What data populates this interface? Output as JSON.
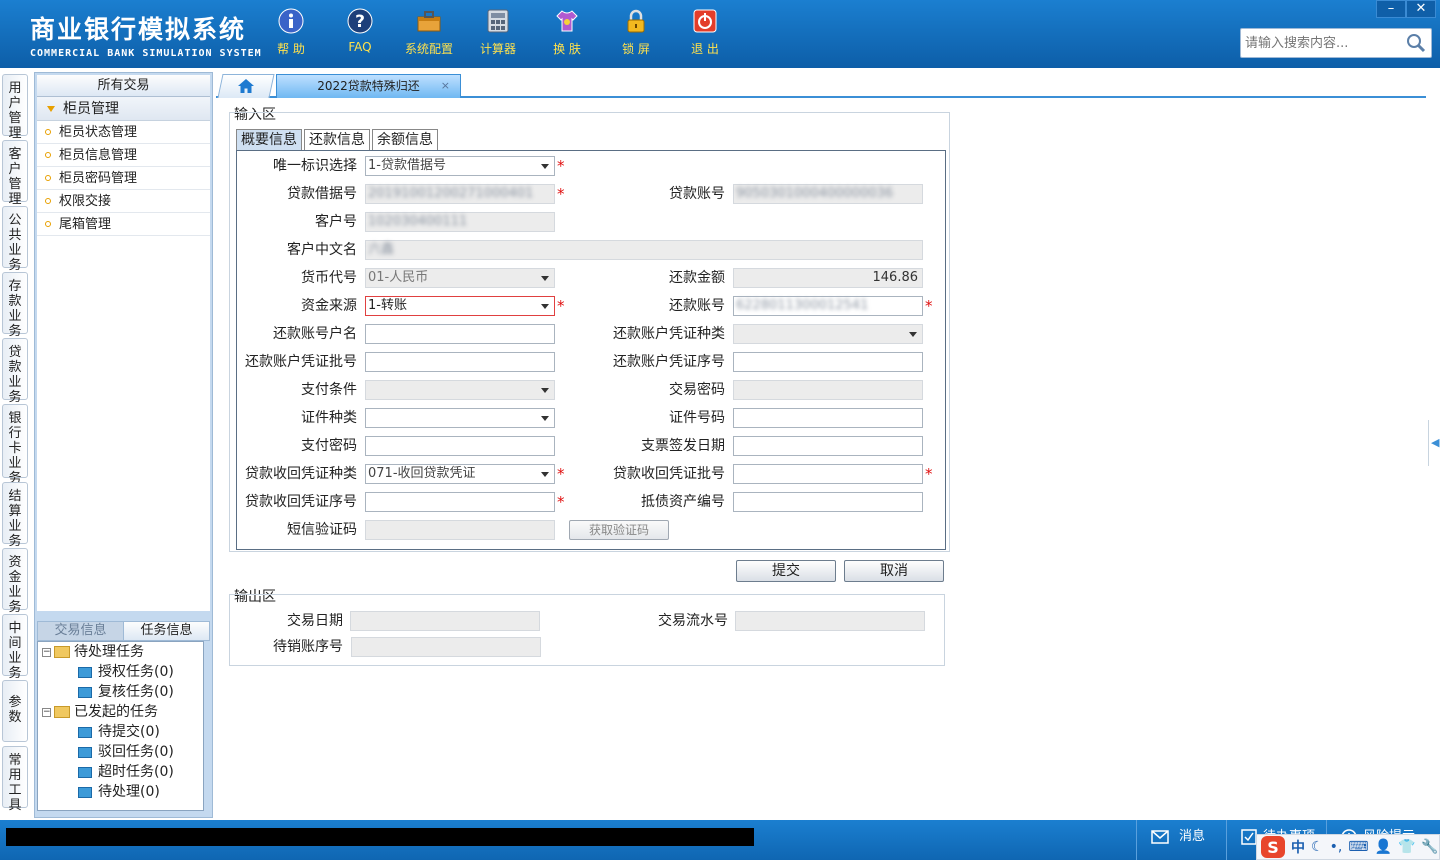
{
  "app": {
    "title_cn": "商业银行模拟系统",
    "title_en": "COMMERCIAL BANK SIMULATION SYSTEM"
  },
  "toolbar": [
    {
      "name": "help",
      "label": "帮 助",
      "icon": "info-icon"
    },
    {
      "name": "faq",
      "label": "FAQ",
      "icon": "question-icon"
    },
    {
      "name": "config",
      "label": "系统配置",
      "icon": "toolbox-icon"
    },
    {
      "name": "calc",
      "label": "计算器",
      "icon": "calculator-icon"
    },
    {
      "name": "skin",
      "label": "换 肤",
      "icon": "shirt-icon"
    },
    {
      "name": "lock",
      "label": "锁 屏",
      "icon": "lock-icon"
    },
    {
      "name": "exit",
      "label": "退 出",
      "icon": "power-icon"
    }
  ],
  "window": {
    "minimize": "–",
    "close": "✕"
  },
  "search": {
    "placeholder": "请输入搜索内容..."
  },
  "vtabs": [
    "用户管理",
    "客户管理",
    "公共业务",
    "存款业务",
    "贷款业务",
    "银行卡业务",
    "结算业务",
    "资金业务",
    "中间业务",
    "参数",
    "常用工具"
  ],
  "sidebar": {
    "header": "所有交易",
    "group": "柜员管理",
    "items": [
      "柜员状态管理",
      "柜员信息管理",
      "柜员密码管理",
      "权限交接",
      "尾箱管理"
    ],
    "tabs": [
      "交易信息",
      "任务信息"
    ],
    "tree": {
      "pending": "待处理任务",
      "auth": "授权任务(0)",
      "review": "复核任务(0)",
      "started": "已发起的任务",
      "to_submit": "待提交(0)",
      "rejected": "驳回任务(0)",
      "timeout": "超时任务(0)",
      "to_process": "待处理(0)"
    }
  },
  "tabs": {
    "current": "2022贷款特殊归还",
    "close": "×"
  },
  "input_area": {
    "title": "输入区",
    "tabs": [
      "概要信息",
      "还款信息",
      "余额信息"
    ],
    "fields": {
      "unique_id_label": "唯一标识选择",
      "unique_id_value": "1-贷款借据号",
      "loan_receipt_label": "贷款借据号",
      "loan_receipt_value": "20191001200271000401",
      "loan_account_label": "贷款账号",
      "loan_account_value": "9050301000400000036",
      "customer_no_label": "客户号",
      "customer_no_value": "102030400111",
      "customer_name_label": "客户中文名",
      "customer_name_value": "六鑫",
      "currency_label": "货币代号",
      "currency_value": "01-人民币",
      "repay_amount_label": "还款金额",
      "repay_amount_value": "146.86",
      "fund_source_label": "资金来源",
      "fund_source_value": "1-转账",
      "repay_account_label": "还款账号",
      "repay_account_value": "6228011300012541",
      "repay_account_name_label": "还款账号户名",
      "repay_voucher_type_label": "还款账户凭证种类",
      "repay_voucher_batch_label": "还款账户凭证批号",
      "repay_voucher_seq_label": "还款账户凭证序号",
      "pay_condition_label": "支付条件",
      "trade_password_label": "交易密码",
      "id_type_label": "证件种类",
      "id_no_label": "证件号码",
      "pay_password_label": "支付密码",
      "cheque_date_label": "支票签发日期",
      "recover_voucher_type_label": "贷款收回凭证种类",
      "recover_voucher_type_value": "071-收回贷款凭证",
      "recover_voucher_batch_label": "贷款收回凭证批号",
      "recover_voucher_seq_label": "贷款收回凭证序号",
      "collateral_no_label": "抵债资产编号",
      "sms_code_label": "短信验证码",
      "get_code_label": "获取验证码"
    },
    "required_mark": "*"
  },
  "buttons": {
    "submit": "提交",
    "cancel": "取消"
  },
  "output_area": {
    "title": "输出区",
    "trade_date_label": "交易日期",
    "serial_no_label": "交易流水号",
    "pending_account_label": "待销账序号"
  },
  "status_bar": {
    "message": "消息",
    "todo": "待办事项",
    "risk": "风险提示"
  },
  "ime": {
    "lang": "中"
  },
  "colors": {
    "header": "#1b7fd0",
    "accent": "#3b8fd6",
    "required": "#e01010",
    "toolbar_text": "#ffe14d"
  }
}
